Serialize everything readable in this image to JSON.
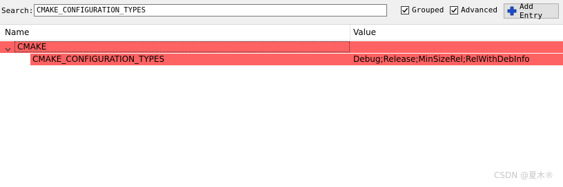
{
  "toolbar": {
    "search_label": "Search:",
    "search_value": "CMAKE_CONFIGURATION_TYPES",
    "grouped_label": "Grouped",
    "grouped_checked": true,
    "advanced_label": "Advanced",
    "advanced_checked": true,
    "add_entry_label": "Add Entry"
  },
  "table": {
    "columns": [
      "Name",
      "Value"
    ],
    "groups": [
      {
        "name": "CMAKE",
        "expanded": true,
        "entries": [
          {
            "name": "CMAKE_CONFIGURATION_TYPES",
            "value": "Debug;Release;MinSizeRel;RelWithDebInfo"
          }
        ]
      }
    ]
  },
  "colors": {
    "changed_row": "#ff6262",
    "add_icon": "#1f4fcf"
  },
  "watermark": "CSDN @夏木®"
}
